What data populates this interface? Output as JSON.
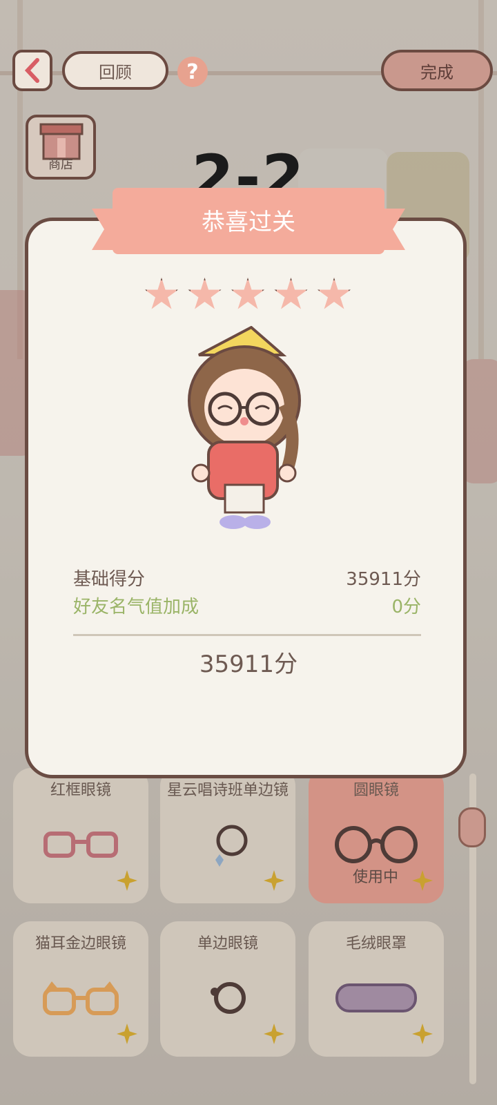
{
  "header": {
    "review_label": "回顾",
    "done_label": "完成",
    "shop_label": "商店"
  },
  "level": {
    "number": "2-2",
    "title": "恭喜过关",
    "stars": 5
  },
  "score": {
    "base_label": "基础得分",
    "base_value": "35911分",
    "bonus_label": "好友名气值加成",
    "bonus_value": "0分",
    "total": "35911分"
  },
  "items": [
    {
      "name": "红框眼镜",
      "status": "",
      "icon": "red-frame-glasses-icon"
    },
    {
      "name": "星云唱诗班单边镜",
      "status": "",
      "icon": "monocle-icon"
    },
    {
      "name": "圆眼镜",
      "status": "使用中",
      "icon": "round-glasses-icon"
    },
    {
      "name": "猫耳金边眼镜",
      "status": "",
      "icon": "cat-ear-glasses-icon"
    },
    {
      "name": "单边眼镜",
      "status": "",
      "icon": "single-lens-icon"
    },
    {
      "name": "毛绒眼罩",
      "status": "",
      "icon": "plush-eye-mask-icon"
    }
  ],
  "colors": {
    "accent": "#f4ab9b",
    "modal_bg": "#f6f3ec",
    "bonus_text": "#9ab467"
  }
}
